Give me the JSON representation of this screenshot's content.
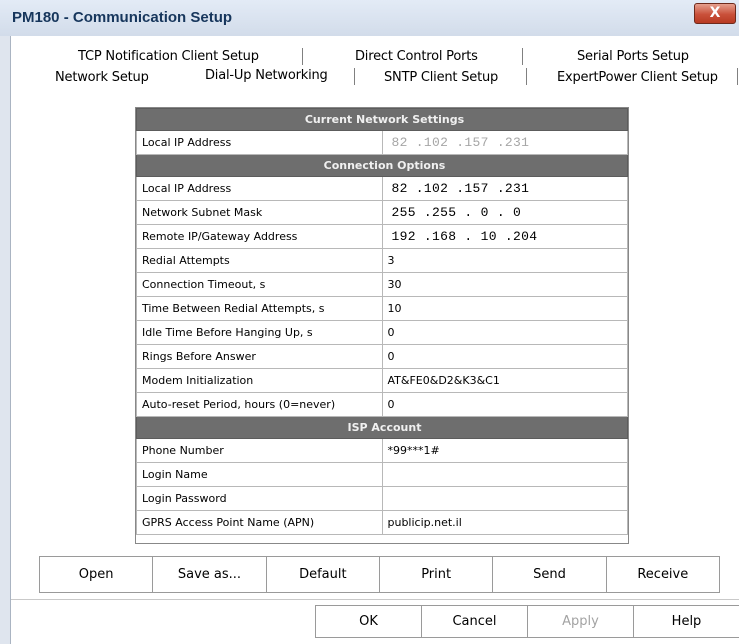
{
  "window": {
    "title": "PM180 - Communication Setup",
    "close_label": "X"
  },
  "tabs": {
    "row1": [
      "TCP Notification Client Setup",
      "Direct Control Ports",
      "Serial Ports Setup"
    ],
    "row2": [
      "Network Setup",
      "Dial-Up Networking",
      "SNTP Client Setup",
      "ExpertPower Client Setup"
    ],
    "active": "Dial-Up Networking"
  },
  "sections": {
    "current": "Current Network Settings",
    "options": "Connection Options",
    "isp": "ISP Account"
  },
  "current_network": {
    "local_ip_label": "Local IP Address",
    "local_ip_value": "82 .102 .157 .231"
  },
  "connection_options": [
    {
      "label": "Local IP Address",
      "value": "82 .102 .157 .231"
    },
    {
      "label": "Network Subnet Mask",
      "value": "255 .255 . 0 . 0"
    },
    {
      "label": "Remote IP/Gateway Address",
      "value": "192 .168 . 10 .204"
    },
    {
      "label": "Redial Attempts",
      "value": "3"
    },
    {
      "label": "Connection Timeout, s",
      "value": "30"
    },
    {
      "label": "Time Between Redial Attempts, s",
      "value": "10"
    },
    {
      "label": "Idle Time Before Hanging Up, s",
      "value": "0"
    },
    {
      "label": "Rings Before Answer",
      "value": "0"
    },
    {
      "label": "Modem Initialization",
      "value": "AT&FE0&D2&K3&C1"
    },
    {
      "label": "Auto-reset Period, hours (0=never)",
      "value": "0"
    }
  ],
  "isp_account": [
    {
      "label": "Phone Number",
      "value": "*99***1#"
    },
    {
      "label": "Login Name",
      "value": ""
    },
    {
      "label": "Login Password",
      "value": ""
    },
    {
      "label": "GPRS Access Point Name (APN)",
      "value": "publicip.net.il"
    }
  ],
  "action_buttons": [
    "Open",
    "Save as...",
    "Default",
    "Print",
    "Send",
    "Receive"
  ],
  "footer_buttons": {
    "ok": "OK",
    "cancel": "Cancel",
    "apply": "Apply",
    "help": "Help"
  }
}
